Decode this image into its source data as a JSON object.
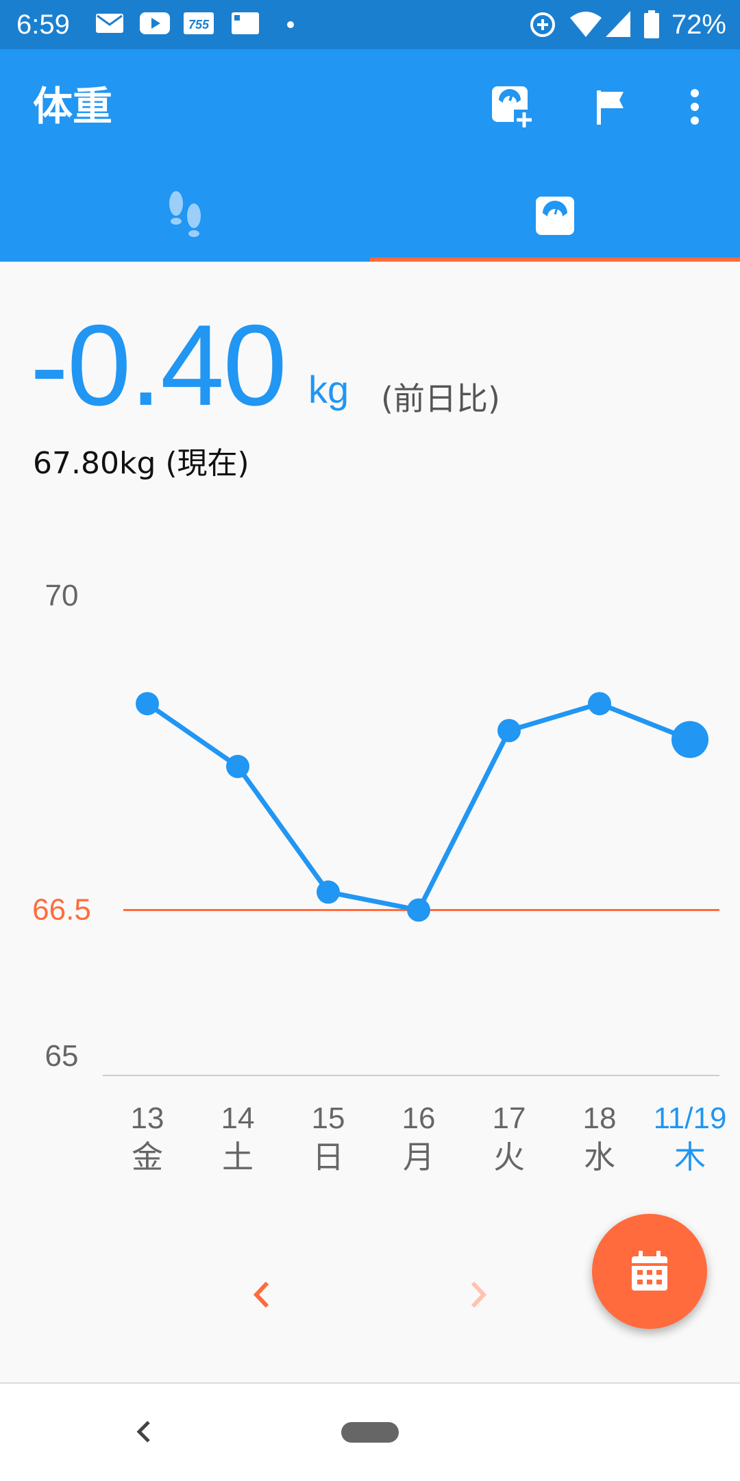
{
  "status_bar": {
    "time": "6:59",
    "notification_icons": [
      "mail-icon",
      "youtube-icon",
      "app-755-icon",
      "au-icon",
      "dot-icon"
    ],
    "system_icons": [
      "data-saver-icon",
      "wifi-icon",
      "signal-icon",
      "battery-icon"
    ],
    "battery": "72%"
  },
  "app_bar": {
    "title": "体重",
    "actions": [
      "add-weight-icon",
      "flag-icon",
      "more-vert-icon"
    ],
    "color": "#2196f3"
  },
  "tabs": [
    {
      "name": "steps",
      "icon": "footsteps-icon",
      "selected": false
    },
    {
      "name": "weight",
      "icon": "scale-icon",
      "selected": true
    }
  ],
  "summary": {
    "diff_value": "-0.40",
    "diff_unit": "kg",
    "diff_note": "(前日比)",
    "current": "67.80kg (現在)"
  },
  "chart_data": {
    "type": "line",
    "x": [
      "13",
      "14",
      "15",
      "16",
      "17",
      "18",
      "11/19"
    ],
    "weekday": [
      "金",
      "土",
      "日",
      "月",
      "火",
      "水",
      "木"
    ],
    "series": [
      {
        "values": [
          68.8,
          68.1,
          66.7,
          66.5,
          68.5,
          68.8,
          68.4
        ]
      }
    ],
    "y_ticks": [
      "70",
      "66.5",
      "65"
    ],
    "ylim": [
      65,
      70
    ],
    "target": 66.5,
    "target_label": "66.5",
    "highlight_index": 6,
    "line_color": "#2196f3",
    "target_color": "#ff6b3d"
  },
  "pager": {
    "prev": "chevron-left-icon",
    "next": "chevron-right-icon"
  },
  "fab": {
    "icon": "calendar-icon",
    "color": "#ff6b3d"
  }
}
